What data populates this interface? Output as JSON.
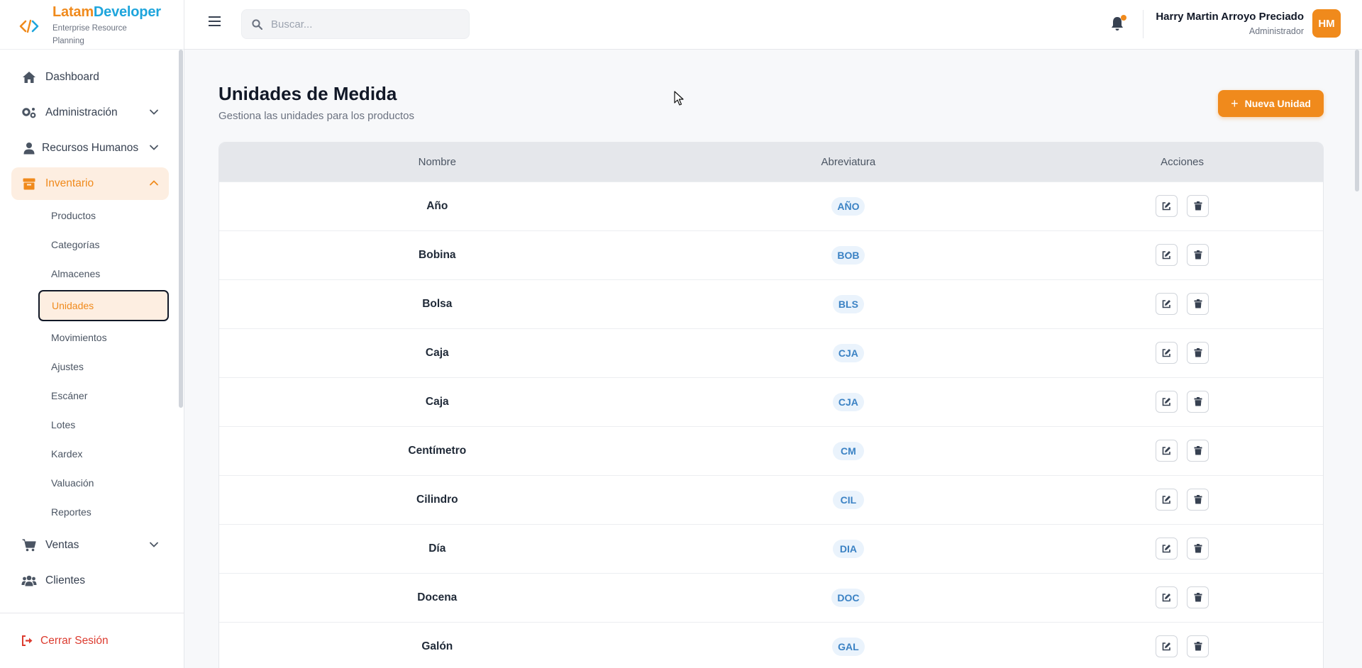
{
  "brand": {
    "name_part1": "Latam",
    "name_part2": "Developer",
    "subtitle": "Enterprise Resource Planning"
  },
  "sidebar": {
    "items": [
      {
        "label": "Dashboard",
        "icon": "home-icon"
      },
      {
        "label": "Administración",
        "icon": "gears-icon"
      },
      {
        "label": "Recursos Humanos",
        "icon": "user-icon"
      },
      {
        "label": "Inventario",
        "icon": "box-icon"
      }
    ],
    "inventory_sub": [
      "Productos",
      "Categorías",
      "Almacenes",
      "Unidades",
      "Movimientos",
      "Ajustes",
      "Escáner",
      "Lotes",
      "Kardex",
      "Valuación",
      "Reportes"
    ],
    "items_after": [
      {
        "label": "Ventas",
        "icon": "cart-icon"
      },
      {
        "label": "Clientes",
        "icon": "users-icon"
      }
    ],
    "logout_label": "Cerrar Sesión"
  },
  "topbar": {
    "search_placeholder": "Buscar...",
    "user_name": "Harry Martin Arroyo Preciado",
    "user_role": "Administrador",
    "avatar_initials": "HM"
  },
  "page": {
    "title": "Unidades de Medida",
    "subtitle": "Gestiona las unidades para los productos",
    "new_button": "Nueva Unidad"
  },
  "table": {
    "headers": [
      "Nombre",
      "Abreviatura",
      "Acciones"
    ],
    "rows": [
      {
        "name": "Año",
        "abbr": "AÑO"
      },
      {
        "name": "Bobina",
        "abbr": "BOB"
      },
      {
        "name": "Bolsa",
        "abbr": "BLS"
      },
      {
        "name": "Caja",
        "abbr": "CJA"
      },
      {
        "name": "Caja",
        "abbr": "CJA"
      },
      {
        "name": "Centímetro",
        "abbr": "CM"
      },
      {
        "name": "Cilindro",
        "abbr": "CIL"
      },
      {
        "name": "Día",
        "abbr": "DIA"
      },
      {
        "name": "Docena",
        "abbr": "DOC"
      },
      {
        "name": "Galón",
        "abbr": "GAL"
      }
    ]
  },
  "colors": {
    "accent": "#f08a1c",
    "brand_blue": "#1ea5dc",
    "logout_red": "#dc3b2f"
  }
}
